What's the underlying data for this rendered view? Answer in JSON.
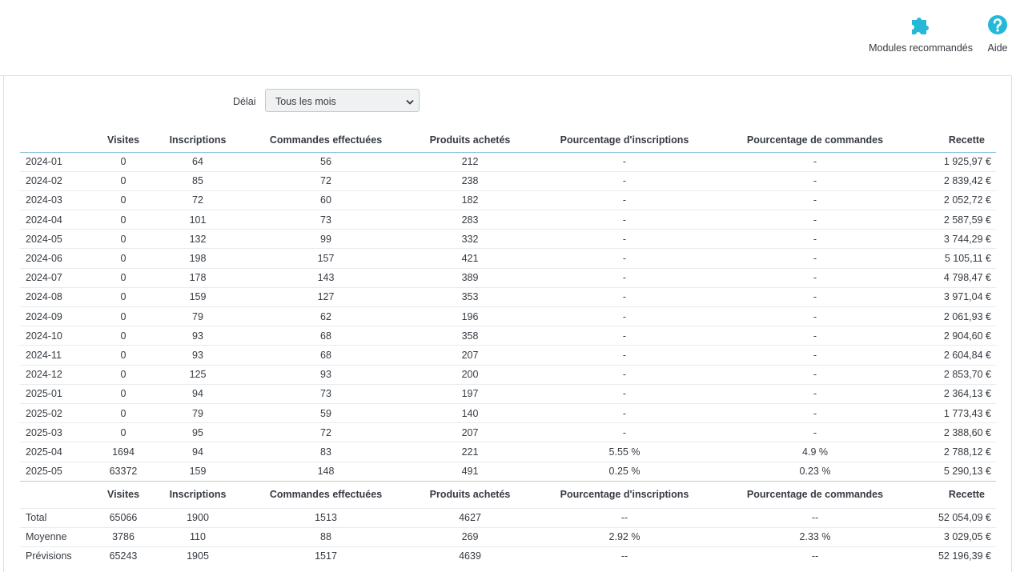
{
  "toolbar": {
    "modules_label": "Modules recommandés",
    "help_label": "Aide",
    "icon_color": "#25b9d7"
  },
  "filter": {
    "label": "Délai",
    "selected": "Tous les mois"
  },
  "columns": [
    "",
    "Visites",
    "Inscriptions",
    "Commandes effectuées",
    "Produits achetés",
    "Pourcentage d'inscriptions",
    "Pourcentage de commandes",
    "Recette"
  ],
  "rows": [
    [
      "2024-01",
      "0",
      "64",
      "56",
      "212",
      "-",
      "-",
      "1 925,97 €"
    ],
    [
      "2024-02",
      "0",
      "85",
      "72",
      "238",
      "-",
      "-",
      "2 839,42 €"
    ],
    [
      "2024-03",
      "0",
      "72",
      "60",
      "182",
      "-",
      "-",
      "2 052,72 €"
    ],
    [
      "2024-04",
      "0",
      "101",
      "73",
      "283",
      "-",
      "-",
      "2 587,59 €"
    ],
    [
      "2024-05",
      "0",
      "132",
      "99",
      "332",
      "-",
      "-",
      "3 744,29 €"
    ],
    [
      "2024-06",
      "0",
      "198",
      "157",
      "421",
      "-",
      "-",
      "5 105,11 €"
    ],
    [
      "2024-07",
      "0",
      "178",
      "143",
      "389",
      "-",
      "-",
      "4 798,47 €"
    ],
    [
      "2024-08",
      "0",
      "159",
      "127",
      "353",
      "-",
      "-",
      "3 971,04 €"
    ],
    [
      "2024-09",
      "0",
      "79",
      "62",
      "196",
      "-",
      "-",
      "2 061,93 €"
    ],
    [
      "2024-10",
      "0",
      "93",
      "68",
      "358",
      "-",
      "-",
      "2 904,60 €"
    ],
    [
      "2024-11",
      "0",
      "93",
      "68",
      "207",
      "-",
      "-",
      "2 604,84 €"
    ],
    [
      "2024-12",
      "0",
      "125",
      "93",
      "200",
      "-",
      "-",
      "2 853,70 €"
    ],
    [
      "2025-01",
      "0",
      "94",
      "73",
      "197",
      "-",
      "-",
      "2 364,13 €"
    ],
    [
      "2025-02",
      "0",
      "79",
      "59",
      "140",
      "-",
      "-",
      "1 773,43 €"
    ],
    [
      "2025-03",
      "0",
      "95",
      "72",
      "207",
      "-",
      "-",
      "2 388,60 €"
    ],
    [
      "2025-04",
      "1694",
      "94",
      "83",
      "221",
      "5.55 %",
      "4.9 %",
      "2 788,12 €"
    ],
    [
      "2025-05",
      "63372",
      "159",
      "148",
      "491",
      "0.25 %",
      "0.23 %",
      "5 290,13 €"
    ]
  ],
  "summary": [
    [
      "Total",
      "65066",
      "1900",
      "1513",
      "4627",
      "--",
      "--",
      "52 054,09 €"
    ],
    [
      "Moyenne",
      "3786",
      "110",
      "88",
      "269",
      "2.92 %",
      "2.33 %",
      "3 029,05 €"
    ],
    [
      "Prévisions",
      "65243",
      "1905",
      "1517",
      "4639",
      "--",
      "--",
      "52 196,39 €"
    ]
  ]
}
